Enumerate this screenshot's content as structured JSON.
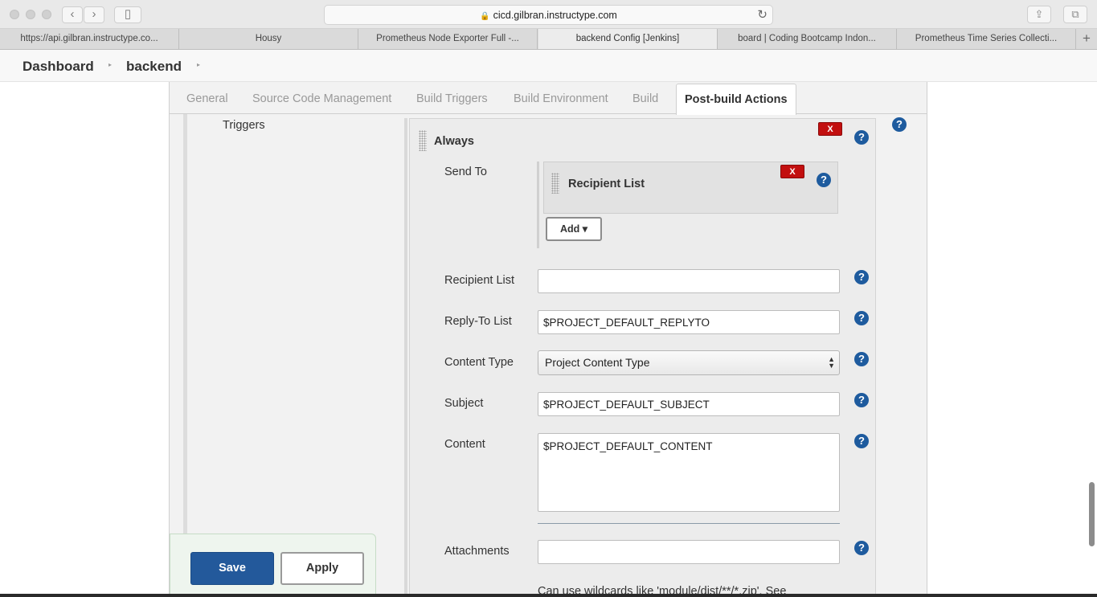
{
  "browser": {
    "url": "cicd.gilbran.instructype.com",
    "back_icon": "‹",
    "forward_icon": "›",
    "sidebar_icon": "▯",
    "share_icon": "⇪",
    "tabs_icon": "⧉",
    "reload_icon": "↻",
    "lock_icon": "🔒",
    "tabs": [
      {
        "label": "https://api.gilbran.instructype.co..."
      },
      {
        "label": "Housy"
      },
      {
        "label": "Prometheus Node Exporter Full -..."
      },
      {
        "label": "backend Config [Jenkins]"
      },
      {
        "label": "board | Coding Bootcamp Indon..."
      },
      {
        "label": "Prometheus Time Series Collecti..."
      }
    ],
    "new_tab_label": "+"
  },
  "breadcrumb": {
    "items": [
      "Dashboard",
      "backend"
    ],
    "separator": "▸"
  },
  "config_tabs": [
    "General",
    "Source Code Management",
    "Build Triggers",
    "Build Environment",
    "Build",
    "Post-build Actions"
  ],
  "left": {
    "triggers_label": "Triggers",
    "save_label": "Save",
    "apply_label": "Apply"
  },
  "always": {
    "title": "Always",
    "delete_label": "X",
    "help_label": "?",
    "send_to_label": "Send To",
    "recipient_panel_title": "Recipient List",
    "add_label": "Add",
    "add_caret": "▾",
    "fields": {
      "recipient_list": {
        "label": "Recipient List",
        "value": ""
      },
      "reply_to": {
        "label": "Reply-To List",
        "value": "$PROJECT_DEFAULT_REPLYTO"
      },
      "content_type": {
        "label": "Content Type",
        "value": "Project Content Type"
      },
      "subject": {
        "label": "Subject",
        "value": "$PROJECT_DEFAULT_SUBJECT"
      },
      "content": {
        "label": "Content",
        "value": "$PROJECT_DEFAULT_CONTENT"
      },
      "attachments": {
        "label": "Attachments",
        "value": ""
      }
    },
    "hint": "Can use wildcards like 'module/dist/**/*.zip'. See"
  },
  "colors": {
    "save_blue": "#23599b",
    "delete_red": "#c20f0f",
    "help_blue": "#1e5b9e"
  }
}
